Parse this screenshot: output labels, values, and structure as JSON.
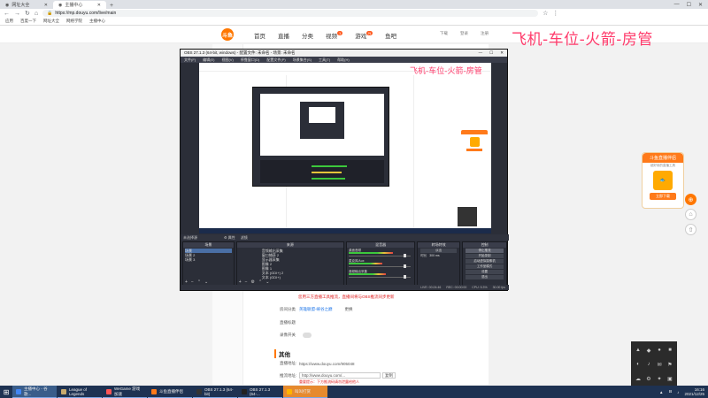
{
  "browser": {
    "tabs": [
      {
        "label": "网址大全",
        "active": false
      },
      {
        "label": "主播中心",
        "active": true
      }
    ],
    "new_tab": "+",
    "window_controls": [
      "—",
      "☐",
      "✕"
    ],
    "url": "https://mp.douyu.com/live/main",
    "bookmarks": [
      "应用",
      "百度一下",
      "网址大全",
      "网络学院",
      "主播中心"
    ]
  },
  "site": {
    "logo_text": "斗鱼",
    "nav": [
      {
        "label": "首页"
      },
      {
        "label": "直播"
      },
      {
        "label": "分类"
      },
      {
        "label": "视频",
        "badge": "1"
      },
      {
        "label": "游戏",
        "badge": "N"
      },
      {
        "label": "鱼吧"
      }
    ],
    "header_right": [
      "下载",
      "登录",
      "注册"
    ],
    "overlay_title": "飞机-车位-火箭-房管"
  },
  "form": {
    "note": "您用三方直播工具推流，直播间将与OBS推流同步更新",
    "rows": [
      {
        "label": "房间分类",
        "value": "英雄联盟-峡谷之巅",
        "link": true,
        "extra": "更换"
      },
      {
        "label": "直播标题",
        "value": ""
      },
      {
        "label": "录像开关",
        "value": ""
      }
    ],
    "section_title": "其他",
    "rtmp_label": "直播地址:",
    "rtmp_value": "https://www.douyu.com/905048",
    "push_label": "推流地址:",
    "push_value": "http://www.douyu.com/...",
    "push_select": "复制",
    "push_note": "重要提示：下方推流码请勿泄露给他人"
  },
  "ad": {
    "title": "斗鱼直播伴侣",
    "subtitle": "超好用的直播工具",
    "button": "立即下载"
  },
  "side_tools": [
    "⊕",
    "⌂",
    "⇧"
  ],
  "obs": {
    "title": "OBS 27.1.3 (64-bit, windows) - 配置文件: 未命名 - 场景: 未命名",
    "menu": [
      "文件(F)",
      "编辑(E)",
      "视图(V)",
      "停靠窗口(D)",
      "配置文件(P)",
      "场景集合(S)",
      "工具(T)",
      "帮助(H)"
    ],
    "inner_title": "飞机-车位-火箭-房管",
    "statusbar": [
      "未选择源",
      "⚙ 属性",
      "滤镜"
    ],
    "docks": {
      "scenes": {
        "title": "场景",
        "items": [
          "场景",
          "场景 2",
          "场景 3"
        ]
      },
      "sources": {
        "title": "来源",
        "items": [
          "音频输出采集",
          "窗口捕获 2",
          "显示器采集",
          "图像 2",
          "图像 1",
          "文本 (GDI+) 2",
          "文本 (GDI+)"
        ]
      },
      "mixer": {
        "title": "混音器",
        "channels": [
          {
            "name": "桌面音频",
            "level": 0.72
          },
          {
            "name": "麦克风/Aux",
            "level": 0.55
          },
          {
            "name": "音频输出采集",
            "level": 0.6
          }
        ]
      },
      "transitions": {
        "title": "转场特效",
        "type": "淡出",
        "duration_label": "时长",
        "duration": "300 ms"
      },
      "controls": {
        "title": "控制",
        "buttons": [
          "停止推流",
          "开始录制",
          "启动虚拟摄像机",
          "工作室模式",
          "设置",
          "退出"
        ]
      }
    },
    "bottom_status": [
      "LIVE: 00:24:46",
      "REC: 00:00:00",
      "CPU: 5.3%",
      "30.00 fps"
    ]
  },
  "tray_icons": [
    "▲",
    "◆",
    "●",
    "■",
    "◐",
    "♪",
    "✉",
    "⚑",
    "☁",
    "⚙",
    "✦",
    "▣"
  ],
  "taskbar": {
    "items": [
      {
        "label": "主播中心 - 谷歌...",
        "color": "#4285f4",
        "active": true
      },
      {
        "label": "League of Legends",
        "color": "#c8aa6e"
      },
      {
        "label": "WeGame 游戏加速",
        "color": "#f55"
      },
      {
        "label": "斗鱼直播伴侣",
        "color": "#ff7a1a"
      },
      {
        "label": "OBS 27.1.3 (64-bit)",
        "color": "#333"
      },
      {
        "label": "OBS 27.1.3 (64-...",
        "color": "#222"
      },
      {
        "label": "叫叫打赏",
        "color": "#ffb400",
        "hilite": true
      }
    ],
    "clock_time": "16:16",
    "clock_date": "2021/12/25"
  }
}
